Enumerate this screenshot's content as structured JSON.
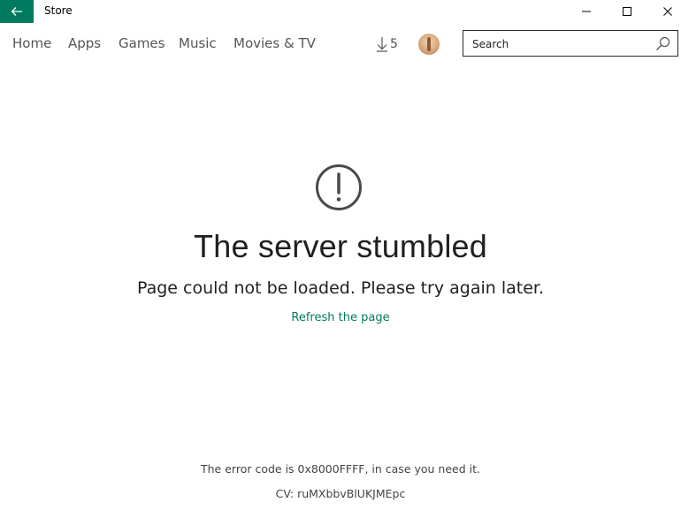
{
  "window": {
    "title": "Store",
    "accent_color": "#007a5e"
  },
  "nav": {
    "items": [
      {
        "label": "Home"
      },
      {
        "label": "Apps"
      },
      {
        "label": "Games"
      },
      {
        "label": "Music"
      },
      {
        "label": "Movies & TV"
      }
    ],
    "downloads_count": "5"
  },
  "search": {
    "placeholder": "Search"
  },
  "error": {
    "icon": "exclamation-circle-icon",
    "heading": "The server stumbled",
    "message": "Page could not be loaded. Please try again later.",
    "refresh_label": "Refresh the page",
    "code_text": "The error code is 0x8000FFFF, in case you need it.",
    "cv_text": "CV: ruMXbbvBlUKJMEpc"
  }
}
